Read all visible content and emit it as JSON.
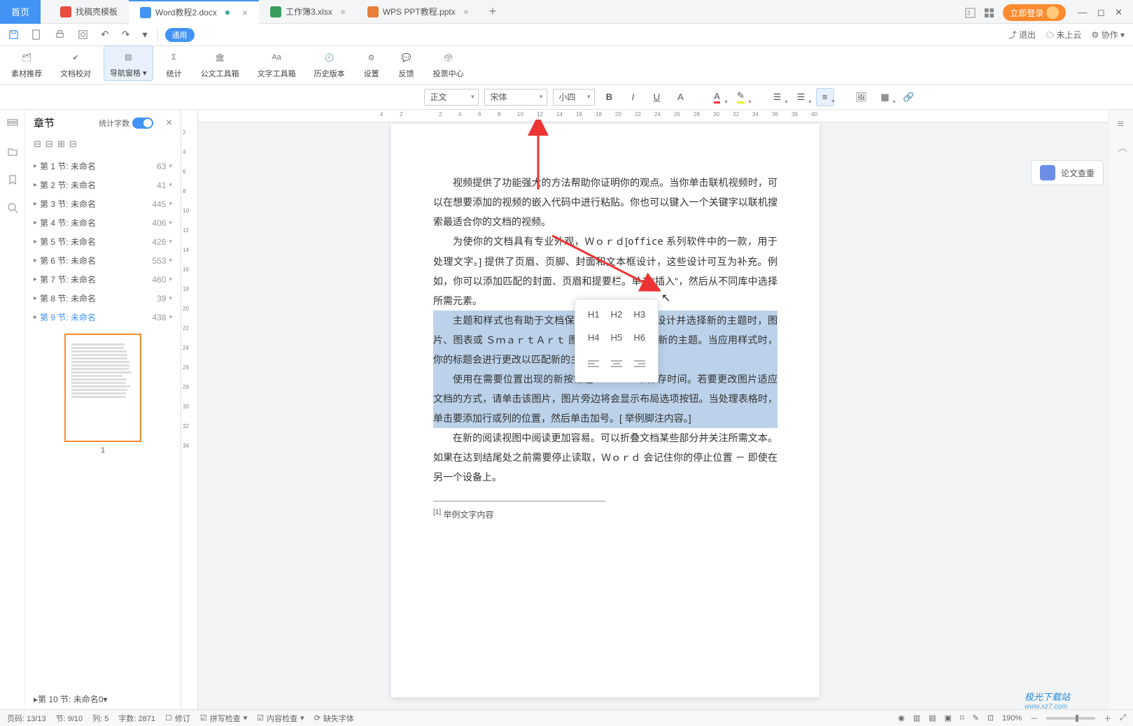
{
  "tabs": {
    "home": "首页",
    "items": [
      {
        "icon": "red",
        "label": "找稿壳模板"
      },
      {
        "icon": "doc",
        "label": "Word教程2.docx",
        "active": true
      },
      {
        "icon": "xls",
        "label": "工作簿3.xlsx"
      },
      {
        "icon": "ppt",
        "label": "WPS PPT教程.pptx"
      }
    ]
  },
  "topRight": {
    "login": "立即登录",
    "exit": "退出",
    "notCloud": "未上云",
    "collab": "协作"
  },
  "quick": {
    "pill": "通用"
  },
  "ribbon": [
    {
      "label": "素材推荐",
      "key": "material"
    },
    {
      "label": "文档校对",
      "key": "proofread"
    },
    {
      "label": "导航窗格",
      "key": "nav",
      "active": true
    },
    {
      "label": "统计",
      "key": "stats"
    },
    {
      "label": "公文工具箱",
      "key": "official"
    },
    {
      "label": "文字工具箱",
      "key": "text-tools"
    },
    {
      "label": "历史版本",
      "key": "history"
    },
    {
      "label": "设置",
      "key": "settings"
    },
    {
      "label": "反馈",
      "key": "feedback"
    },
    {
      "label": "投票中心",
      "key": "vote"
    }
  ],
  "format": {
    "style": "正文",
    "font": "宋体",
    "size": "小四"
  },
  "chapters": {
    "title": "章节",
    "wordCountLabel": "统计字数",
    "items": [
      {
        "name": "第 1 节: 未命名",
        "count": 63
      },
      {
        "name": "第 2 节: 未命名",
        "count": 41
      },
      {
        "name": "第 3 节: 未命名",
        "count": 445
      },
      {
        "name": "第 4 节: 未命名",
        "count": 406
      },
      {
        "name": "第 5 节: 未命名",
        "count": 426
      },
      {
        "name": "第 6 节: 未命名",
        "count": 553
      },
      {
        "name": "第 7 节: 未命名",
        "count": 460
      },
      {
        "name": "第 8 节: 未命名",
        "count": 39
      },
      {
        "name": "第 9 节: 未命名",
        "count": 438,
        "selected": true
      }
    ],
    "last": {
      "name": "第 10 节: 未命名",
      "count": 0
    },
    "thumbPage": "1"
  },
  "document": {
    "para1": "视频提供了功能强大的方法帮助你证明你的观点。当你单击联机视频时，可以在想要添加的视频的嵌入代码中进行粘贴。你也可以键入一个关键字以联机搜索最适合你的文档的视频。",
    "para2a": "为使你的文档具有专业外观，Ｗｏｒｄ[",
    "para2bracket": "office",
    "para2b": " 系列软件中的一款，用于处理文字。]   提供了页眉、页脚、封面和文本框设计，这些设计可互为补充。例如，你可以添加匹配的封面、页眉和提要栏。单击\"插入\"，然后从不同库中选择所需元素。",
    "para3": "主题和样式也有助于文档保持协调。当你单击设计并选择新的主题时，图片、图表或  ＳｍａｒｔＡｒｔ  图形将会更改以匹配新的主题。当应用样式时，你的标题会进行更改以匹配新的主题。",
    "para4": "使用在需要位置出现的新按钮在  Ｗｏｒｄ中保存时间。若要更改图片适应文档的方式，请单击该图片，图片旁边将会显示布局选项按钮。当处理表格时，单击要添加行或列的位置，然后单击加号。[ 举例脚注内容。]",
    "para5": "在新的阅读视图中阅读更加容易。可以折叠文档某些部分并关注所需文本。如果在达到结尾处之前需要停止读取，Ｗｏｒｄ  会记住你的停止位置  － 即使在另一个设备上。",
    "footnoteMark": "[1]",
    "footnoteText": "举例文字内容"
  },
  "headingPopup": {
    "h1": "H1",
    "h2": "H2",
    "h3": "H3",
    "h4": "H4",
    "h5": "H5",
    "h6": "H6"
  },
  "rightSide": {
    "citation": "论文查重"
  },
  "status": {
    "page": "页码: 13/13",
    "section": "节: 9/10",
    "column": "列: 5",
    "wordCount": "字数: 2871",
    "revise": "修订",
    "spell": "拼写检查",
    "content": "内容检查",
    "missingFont": "缺失字体",
    "zoom": "190%"
  },
  "watermark": {
    "main": "极光下载站",
    "sub": "www.xz7.com"
  },
  "rulerH": [
    4,
    2,
    "",
    2,
    4,
    6,
    8,
    10,
    12,
    14,
    16,
    18,
    20,
    22,
    24,
    26,
    28,
    30,
    32,
    34,
    36,
    38,
    40
  ],
  "rulerV": [
    2,
    4,
    6,
    8,
    10,
    12,
    14,
    16,
    18,
    20,
    22,
    24,
    26,
    28,
    30,
    32,
    34
  ]
}
